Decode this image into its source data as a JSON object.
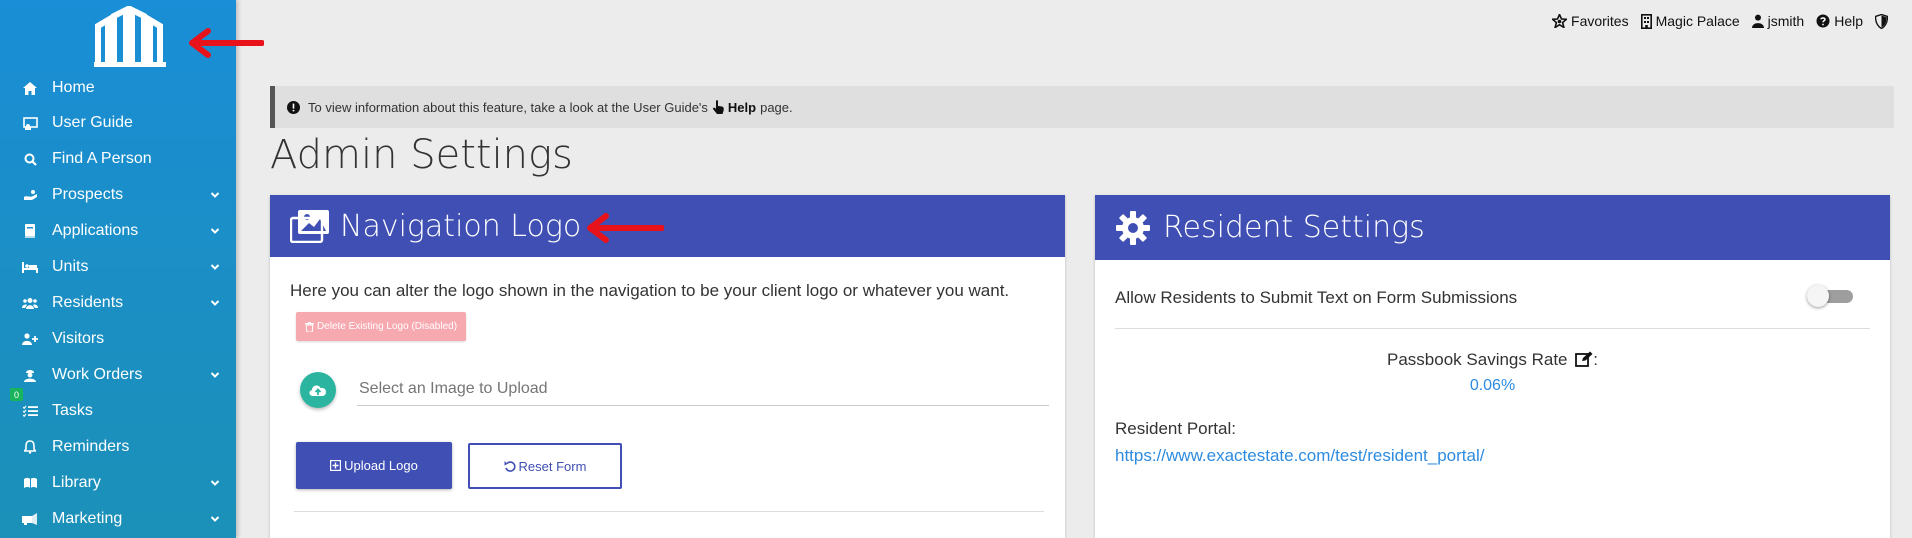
{
  "sidebar": {
    "items": [
      {
        "label": "Home",
        "icon": "home-icon",
        "has_chevron": false
      },
      {
        "label": "User Guide",
        "icon": "user-guide-icon",
        "has_chevron": false
      },
      {
        "label": "Find A Person",
        "icon": "search-icon",
        "has_chevron": false
      },
      {
        "label": "Prospects",
        "icon": "prospects-icon",
        "has_chevron": true
      },
      {
        "label": "Applications",
        "icon": "book-icon",
        "has_chevron": true
      },
      {
        "label": "Units",
        "icon": "bed-icon",
        "has_chevron": true
      },
      {
        "label": "Residents",
        "icon": "users-icon",
        "has_chevron": true
      },
      {
        "label": "Visitors",
        "icon": "user-plus-icon",
        "has_chevron": false
      },
      {
        "label": "Work Orders",
        "icon": "worker-icon",
        "has_chevron": true
      },
      {
        "label": "Tasks",
        "icon": "tasks-icon",
        "has_chevron": false,
        "badge": "0"
      },
      {
        "label": "Reminders",
        "icon": "bell-icon",
        "has_chevron": false
      },
      {
        "label": "Library",
        "icon": "library-icon",
        "has_chevron": true
      },
      {
        "label": "Marketing",
        "icon": "marketing-icon",
        "has_chevron": true
      }
    ]
  },
  "topbar": {
    "favorites": "Favorites",
    "property": "Magic Palace",
    "user": "jsmith",
    "help": "Help"
  },
  "info": {
    "text_before": "To view information about this feature, take a look at the User Guide's",
    "help_label": "Help",
    "text_after": "page."
  },
  "page_title": "Admin Settings",
  "nav_logo_card": {
    "title": "Navigation Logo",
    "description": "Here you can alter the logo shown in the navigation to be your client logo or whatever you want.",
    "delete_button": "Delete Existing Logo (Disabled)",
    "file_placeholder": "Select an Image to Upload",
    "upload_button": "Upload Logo",
    "reset_button": "Reset Form"
  },
  "resident_card": {
    "title": "Resident Settings",
    "allow_text_label": "Allow Residents to Submit Text on Form Submissions",
    "allow_text_enabled": false,
    "passbook_label": "Passbook Savings Rate",
    "passbook_suffix": ":",
    "passbook_value": "0.06%",
    "portal_label": "Resident Portal:",
    "portal_url": "https://www.exactestate.com/test/resident_portal/"
  },
  "colors": {
    "sidebar": "#1a8ed6",
    "card_header": "#3f4fb3",
    "accent_link": "#2d8be0",
    "upload_teal": "#2bb5a0",
    "delete_disabled": "#f7a9b0",
    "annotation_arrow": "#e8121b"
  }
}
